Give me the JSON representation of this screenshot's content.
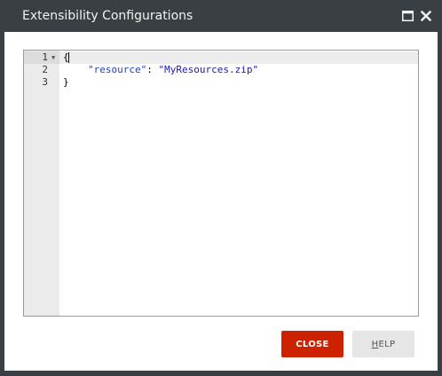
{
  "window": {
    "title": "Extensibility Configurations"
  },
  "editor": {
    "lines": [
      {
        "number": "1",
        "text": "{"
      },
      {
        "number": "2",
        "key": "\"resource\"",
        "sep": ": ",
        "value": "\"MyResources.zip\""
      },
      {
        "number": "3",
        "text": "}"
      }
    ]
  },
  "footer": {
    "close_label": "CLOSE",
    "help_first": "H",
    "help_rest": "ELP"
  },
  "colors": {
    "titlebar": "#3a3f43",
    "close_button": "#cc2200",
    "help_button": "#e6e6e6"
  },
  "icons": {
    "maximize": "maximize-icon",
    "close": "close-icon",
    "fold": "fold-arrow-icon"
  }
}
